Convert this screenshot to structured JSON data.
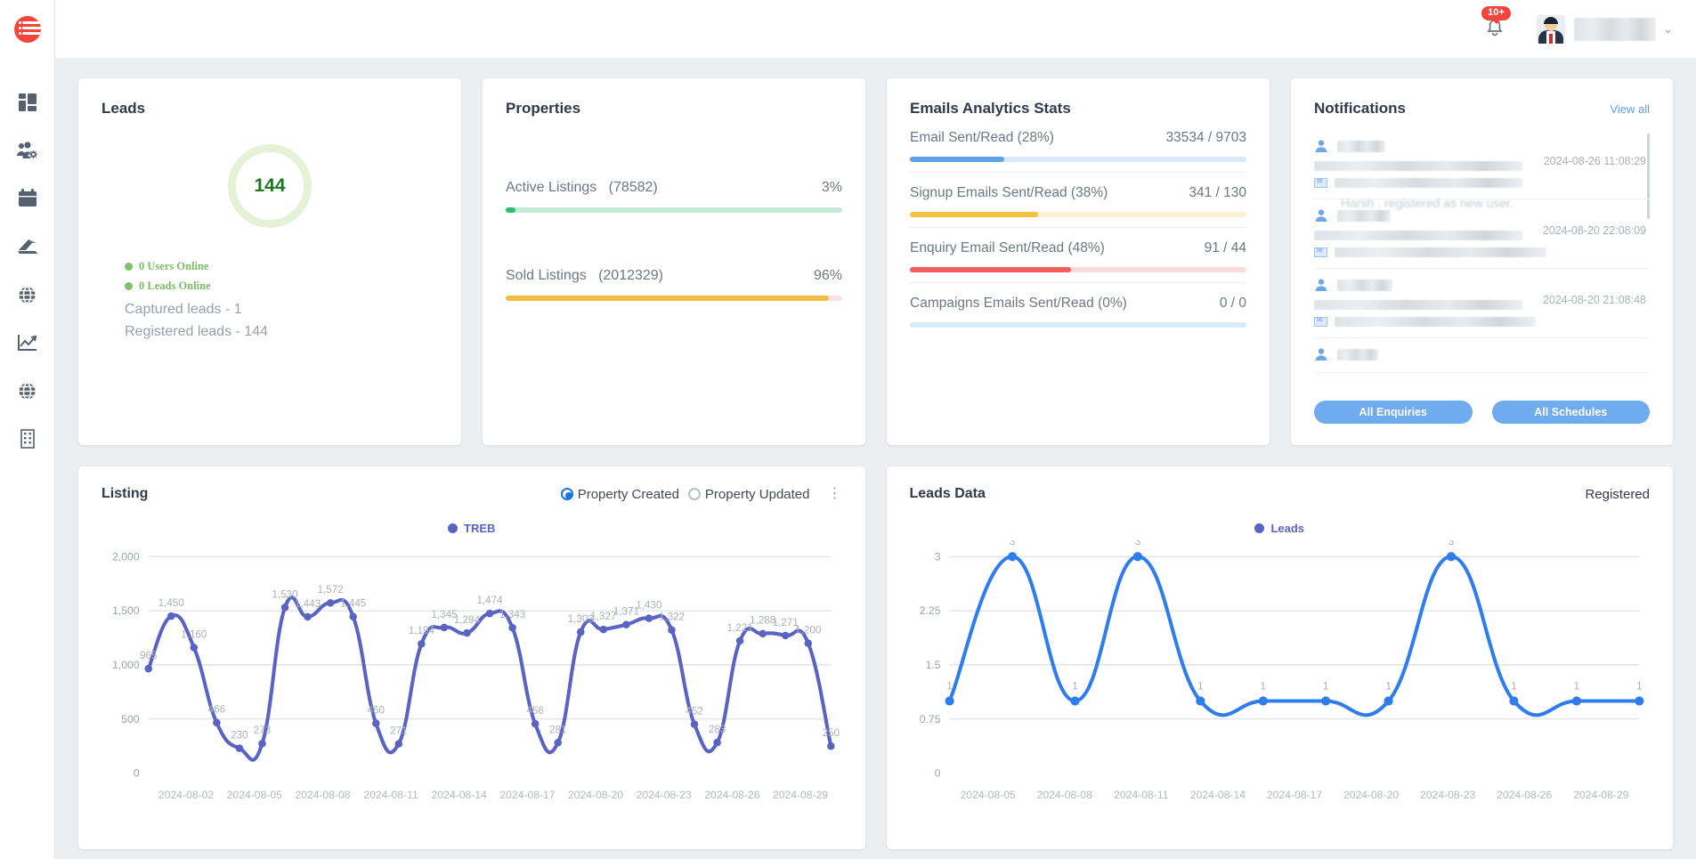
{
  "header": {
    "notification_badge": "10+",
    "bell_icon": "bell-icon",
    "avatar_icon": "user-avatar",
    "chevron": "⌄"
  },
  "sidebar": {
    "logo": "brand-logo",
    "items": [
      {
        "icon": "dashboard-grid-icon",
        "name": "sidebar-item-dashboard"
      },
      {
        "icon": "users-settings-icon",
        "name": "sidebar-item-users"
      },
      {
        "icon": "calendar-icon",
        "name": "sidebar-item-calendar"
      },
      {
        "icon": "listings-icon",
        "name": "sidebar-item-listings"
      },
      {
        "icon": "globe-icon",
        "name": "sidebar-item-web"
      },
      {
        "icon": "analytics-chart-icon",
        "name": "sidebar-item-analytics"
      },
      {
        "icon": "globe-icon",
        "name": "sidebar-item-sites"
      },
      {
        "icon": "building-icon",
        "name": "sidebar-item-offices"
      }
    ]
  },
  "leads_card": {
    "title": "Leads",
    "donut_value": "144",
    "users_online": "0 Users Online",
    "leads_online": "0 Leads Online",
    "captured": "Captured leads - 1",
    "registered": "Registered leads - 144",
    "accent": "#1a7a1f",
    "ring": "#e6f2d8"
  },
  "properties_card": {
    "title": "Properties",
    "rows": [
      {
        "label": "Active Listings",
        "count": "(78582)",
        "pct_label": "3%",
        "pct": 3,
        "fill": "#25c16f",
        "track": "#c5ead4"
      },
      {
        "label": "Sold Listings",
        "count": "(2012329)",
        "pct_label": "96%",
        "pct": 96,
        "fill": "#f3bd45",
        "track": "#fbe2e4"
      }
    ]
  },
  "emails_card": {
    "title": "Emails Analytics Stats",
    "rows": [
      {
        "label": "Email Sent/Read (28%)",
        "value": "33534 / 9703",
        "pct": 28,
        "fill": "#5fa2e8",
        "track": "#daeafb"
      },
      {
        "label": "Signup Emails Sent/Read (38%)",
        "value": "341 / 130",
        "pct": 38,
        "fill": "#f4c141",
        "track": "#fdf0d4"
      },
      {
        "label": "Enquiry Email Sent/Read (48%)",
        "value": "91 / 44",
        "pct": 48,
        "fill": "#f45c5c",
        "track": "#fbdcdc"
      },
      {
        "label": "Campaigns Emails Sent/Read (0%)",
        "value": "0 / 0",
        "pct": 0,
        "fill": "#5fa2e8",
        "track": "#d9eaf9"
      }
    ]
  },
  "notifications_card": {
    "title": "Notifications",
    "view_all": "View all",
    "items": [
      {
        "timestamp": "2024-08-26 11:08:29",
        "ghost": "Harsh , registered as new user."
      },
      {
        "timestamp": "2024-08-20 22:08:09",
        "ghost": ""
      },
      {
        "timestamp": "2024-08-20 21:08:48",
        "ghost": ""
      }
    ],
    "all_enquiries": "All Enquiries",
    "all_schedules": "All Schedules"
  },
  "listing_chart": {
    "title": "Listing",
    "radio_created": "Property Created",
    "radio_updated": "Property Updated",
    "selected": "Property Created",
    "menu_icon": "kebab-menu-icon"
  },
  "leads_chart": {
    "title": "Leads Data",
    "right_label": "Registered"
  },
  "chart_data": [
    {
      "type": "line",
      "title": "Listing",
      "legend": [
        "TREB"
      ],
      "legend_position": "top-center",
      "series_color": "#5a63c4",
      "xlabel": "",
      "ylabel": "",
      "ylim": [
        0,
        2000
      ],
      "yticks": [
        "0",
        "500",
        "1,000",
        "1,500",
        "2,000"
      ],
      "grid": true,
      "xticks": [
        "2024-08-02",
        "2024-08-05",
        "2024-08-08",
        "2024-08-11",
        "2024-08-14",
        "2024-08-17",
        "2024-08-20",
        "2024-08-23",
        "2024-08-26",
        "2024-08-29"
      ],
      "series": [
        {
          "name": "TREB",
          "x": [
            "2024-08-01",
            "2024-08-02",
            "2024-08-03",
            "2024-08-04",
            "2024-08-05",
            "2024-08-06",
            "2024-08-07",
            "2024-08-08",
            "2024-08-09",
            "2024-08-10",
            "2024-08-11",
            "2024-08-12",
            "2024-08-13",
            "2024-08-14",
            "2024-08-15",
            "2024-08-16",
            "2024-08-17",
            "2024-08-18",
            "2024-08-19",
            "2024-08-20",
            "2024-08-21",
            "2024-08-22",
            "2024-08-23",
            "2024-08-24",
            "2024-08-25",
            "2024-08-26",
            "2024-08-27",
            "2024-08-28",
            "2024-08-29",
            "2024-08-30"
          ],
          "values": [
            965,
            1450,
            1160,
            466,
            230,
            273,
            1530,
            1443,
            1572,
            1445,
            460,
            271,
            1194,
            1345,
            1294,
            1474,
            1343,
            456,
            281,
            1303,
            1327,
            1371,
            1430,
            1322,
            452,
            283,
            1221,
            1288,
            1271,
            1200,
            250
          ]
        }
      ],
      "point_labels": [
        "965",
        "1,450",
        "1,160",
        "466",
        "230",
        "273",
        "1,530",
        "1,443",
        "1,572",
        "1,445",
        "460",
        "271",
        "1,194",
        "1,345",
        "1,294",
        "1,474",
        "1,343",
        "456",
        "281",
        "1,303",
        "1,327",
        "1,371",
        "1,430",
        "1,322",
        "452",
        "283",
        "1,221",
        "1,288",
        "1,271",
        "1,200",
        "250"
      ]
    },
    {
      "type": "line",
      "title": "Leads Data",
      "legend": [
        "Leads"
      ],
      "legend_position": "top-center",
      "series_color": "#2f7ded",
      "xlabel": "",
      "ylabel": "",
      "ylim": [
        0,
        3
      ],
      "yticks": [
        "0",
        "0.75",
        "1.5",
        "2.25",
        "3"
      ],
      "grid": true,
      "xticks": [
        "2024-08-05",
        "2024-08-08",
        "2024-08-11",
        "2024-08-14",
        "2024-08-17",
        "2024-08-20",
        "2024-08-23",
        "2024-08-26",
        "2024-08-29"
      ],
      "series": [
        {
          "name": "Leads",
          "x": [
            "2024-08-04",
            "2024-08-05",
            "2024-08-10",
            "2024-08-11",
            "2024-08-12",
            "2024-08-16",
            "2024-08-18",
            "2024-08-19",
            "2024-08-20",
            "2024-08-26",
            "2024-08-28",
            "2024-08-29"
          ],
          "values": [
            1,
            3,
            1,
            3,
            1,
            1,
            1,
            1,
            3,
            1,
            1,
            1
          ]
        }
      ],
      "point_labels": [
        "1",
        "3",
        "1",
        "3",
        "1",
        "1",
        "1",
        "1",
        "3",
        "1",
        "1",
        "1"
      ]
    }
  ]
}
